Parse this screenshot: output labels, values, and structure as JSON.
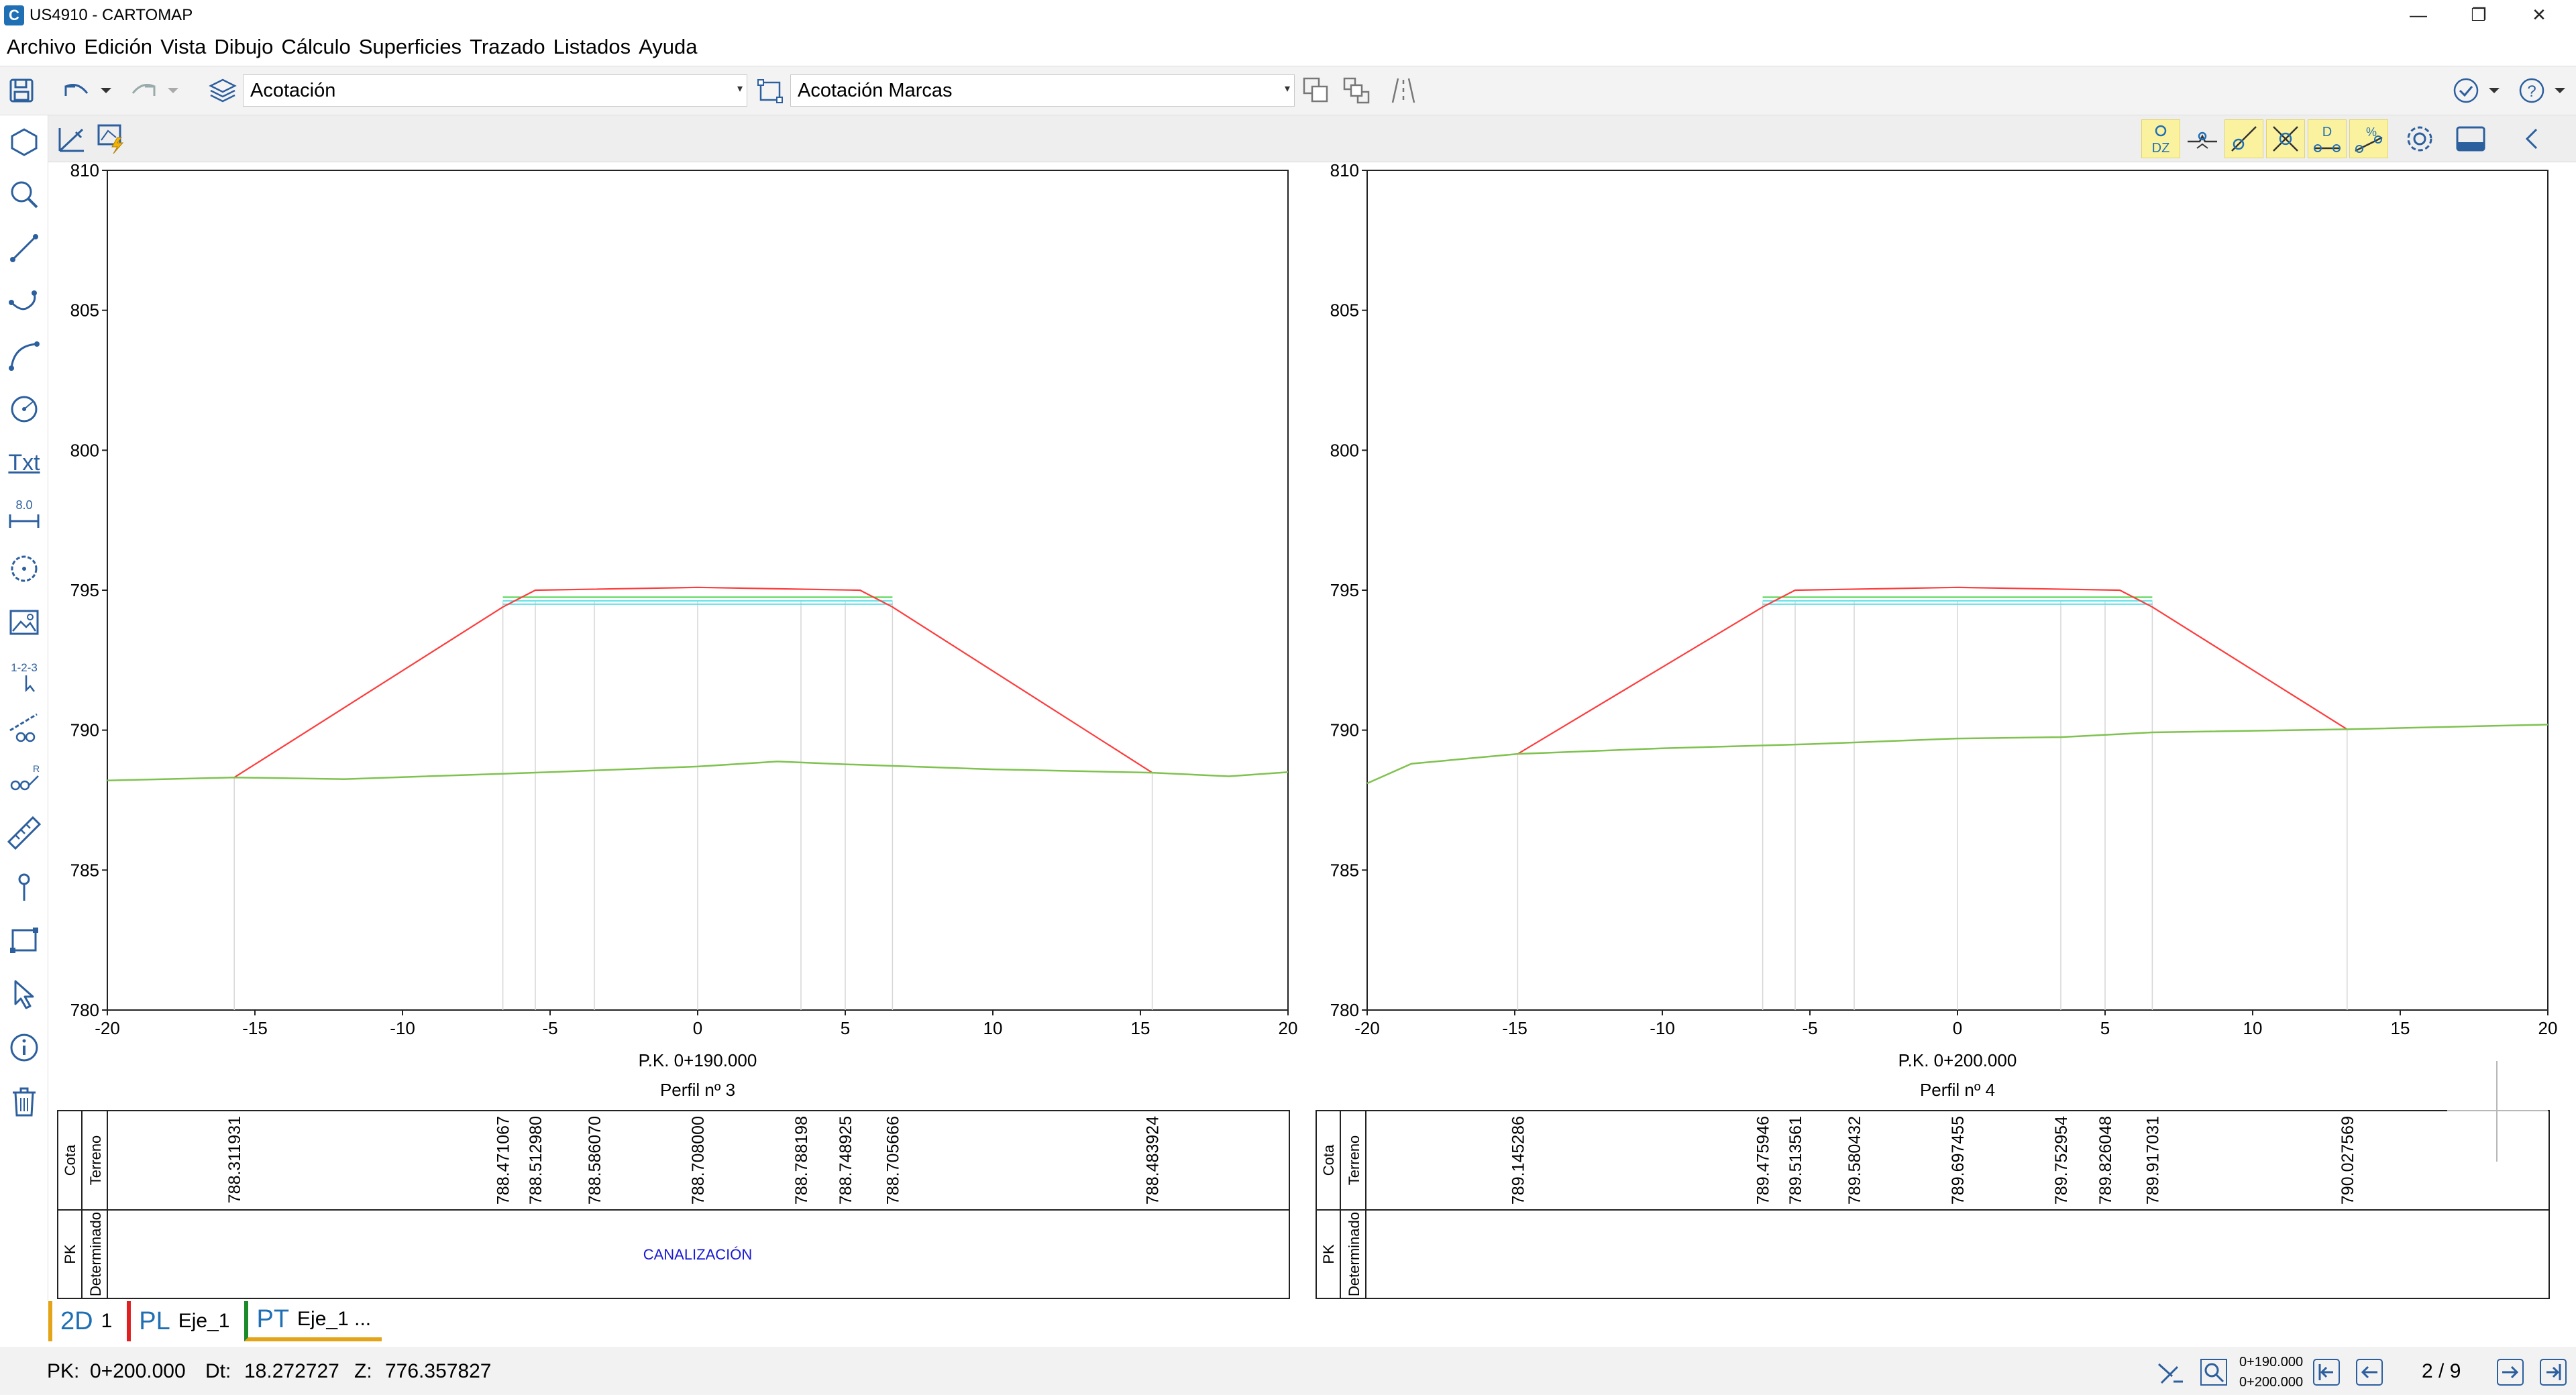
{
  "window": {
    "title": "US4910 - CARTOMAP"
  },
  "menu": [
    "Archivo",
    "Edición",
    "Vista",
    "Dibujo",
    "Cálculo",
    "Superficies",
    "Trazado",
    "Listados",
    "Ayuda"
  ],
  "toolbar": {
    "layer_combo": "Acotación",
    "style_combo": "Acotación Marcas"
  },
  "toolbar2": {
    "dz_label": "DZ",
    "d_label": "D",
    "pct_label": "%"
  },
  "left_tools": {
    "txt_label": "Txt",
    "dim_label": "8.0",
    "numbering_label": "1-2-3"
  },
  "profiles": [
    {
      "pk_label": "P.K. 0+190.000",
      "name": "Perfil nº 3",
      "y_ticks": [
        "810",
        "805",
        "800",
        "795",
        "790",
        "785",
        "780"
      ],
      "x_ticks": [
        "-20",
        "-15",
        "-10",
        "-5",
        "0",
        "5",
        "10",
        "15",
        "20"
      ],
      "xlim": [
        -20,
        20
      ],
      "ylim": [
        780,
        810
      ],
      "terrain": [
        [
          -20,
          788.2
        ],
        [
          -15.7,
          788.31
        ],
        [
          -12,
          788.25
        ],
        [
          -5,
          788.5
        ],
        [
          0,
          788.7
        ],
        [
          2.7,
          788.88
        ],
        [
          5,
          788.78
        ],
        [
          10,
          788.6
        ],
        [
          15.4,
          788.48
        ],
        [
          18,
          788.35
        ],
        [
          20,
          788.5
        ]
      ],
      "platform": [
        [
          -15.7,
          788.31
        ],
        [
          -6.6,
          794.4
        ],
        [
          -5.5,
          795.0
        ],
        [
          0,
          795.1
        ],
        [
          5.5,
          795.0
        ],
        [
          6.6,
          794.4
        ],
        [
          15.4,
          788.48
        ]
      ],
      "table_values": [
        "788.311931",
        "788.471067",
        "788.512980",
        "788.586070",
        "788.708000",
        "788.788198",
        "788.748925",
        "788.705666",
        "788.483924"
      ],
      "table_x": [
        -15.7,
        -6.6,
        -5.5,
        -3.5,
        0,
        3.5,
        5.0,
        6.6,
        15.4
      ],
      "determinado_text": "CANALIZACIÓN"
    },
    {
      "pk_label": "P.K. 0+200.000",
      "name": "Perfil nº 4",
      "y_ticks": [
        "810",
        "805",
        "800",
        "795",
        "790",
        "785",
        "780"
      ],
      "x_ticks": [
        "-20",
        "-15",
        "-10",
        "-5",
        "0",
        "5",
        "10",
        "15",
        "20"
      ],
      "xlim": [
        -20,
        20
      ],
      "ylim": [
        780,
        810
      ],
      "terrain": [
        [
          -20,
          788.1
        ],
        [
          -18.5,
          788.8
        ],
        [
          -14.9,
          789.15
        ],
        [
          -10,
          789.35
        ],
        [
          -5,
          789.5
        ],
        [
          0,
          789.7
        ],
        [
          3.5,
          789.75
        ],
        [
          6.6,
          789.92
        ],
        [
          13.2,
          790.03
        ],
        [
          20,
          790.2
        ]
      ],
      "platform": [
        [
          -14.9,
          789.15
        ],
        [
          -6.6,
          794.4
        ],
        [
          -5.5,
          795.0
        ],
        [
          0,
          795.1
        ],
        [
          5.5,
          795.0
        ],
        [
          6.6,
          794.4
        ],
        [
          13.2,
          790.03
        ]
      ],
      "table_values": [
        "789.145286",
        "789.475946",
        "789.513561",
        "789.580432",
        "789.697455",
        "789.752954",
        "789.826048",
        "789.917031",
        "790.027569"
      ],
      "table_x": [
        -14.9,
        -6.6,
        -5.5,
        -3.5,
        0,
        3.5,
        5.0,
        6.6,
        13.2
      ],
      "determinado_text": ""
    }
  ],
  "table_labels": {
    "cota": "Cota",
    "terreno": "Terreno",
    "pk": "PK",
    "determinado": "Determinado"
  },
  "tabs": [
    {
      "prefix": "2D",
      "label": "1",
      "color": "#e3a417"
    },
    {
      "prefix": "PL",
      "label": "Eje_1",
      "color": "#e02020"
    },
    {
      "prefix": "PT",
      "label": "Eje_1 ...",
      "color": "#1c8a2a"
    }
  ],
  "status": {
    "pk_label": "PK:",
    "pk_value": "0+200.000",
    "dt_label": "Dt:",
    "dt_value": "18.272727",
    "z_label": "Z:",
    "z_value": "776.357827",
    "range_top": "0+190.000",
    "range_bottom": "0+200.000",
    "page": "2 / 9"
  },
  "colors": {
    "terrain": "#7fc24f",
    "platform": "#ff3b3b",
    "layer_green": "#4cd44c",
    "layer_cyan": "#5fe0e8",
    "blue_text": "#1a1ad6",
    "icon_blue": "#2c5f9e"
  }
}
